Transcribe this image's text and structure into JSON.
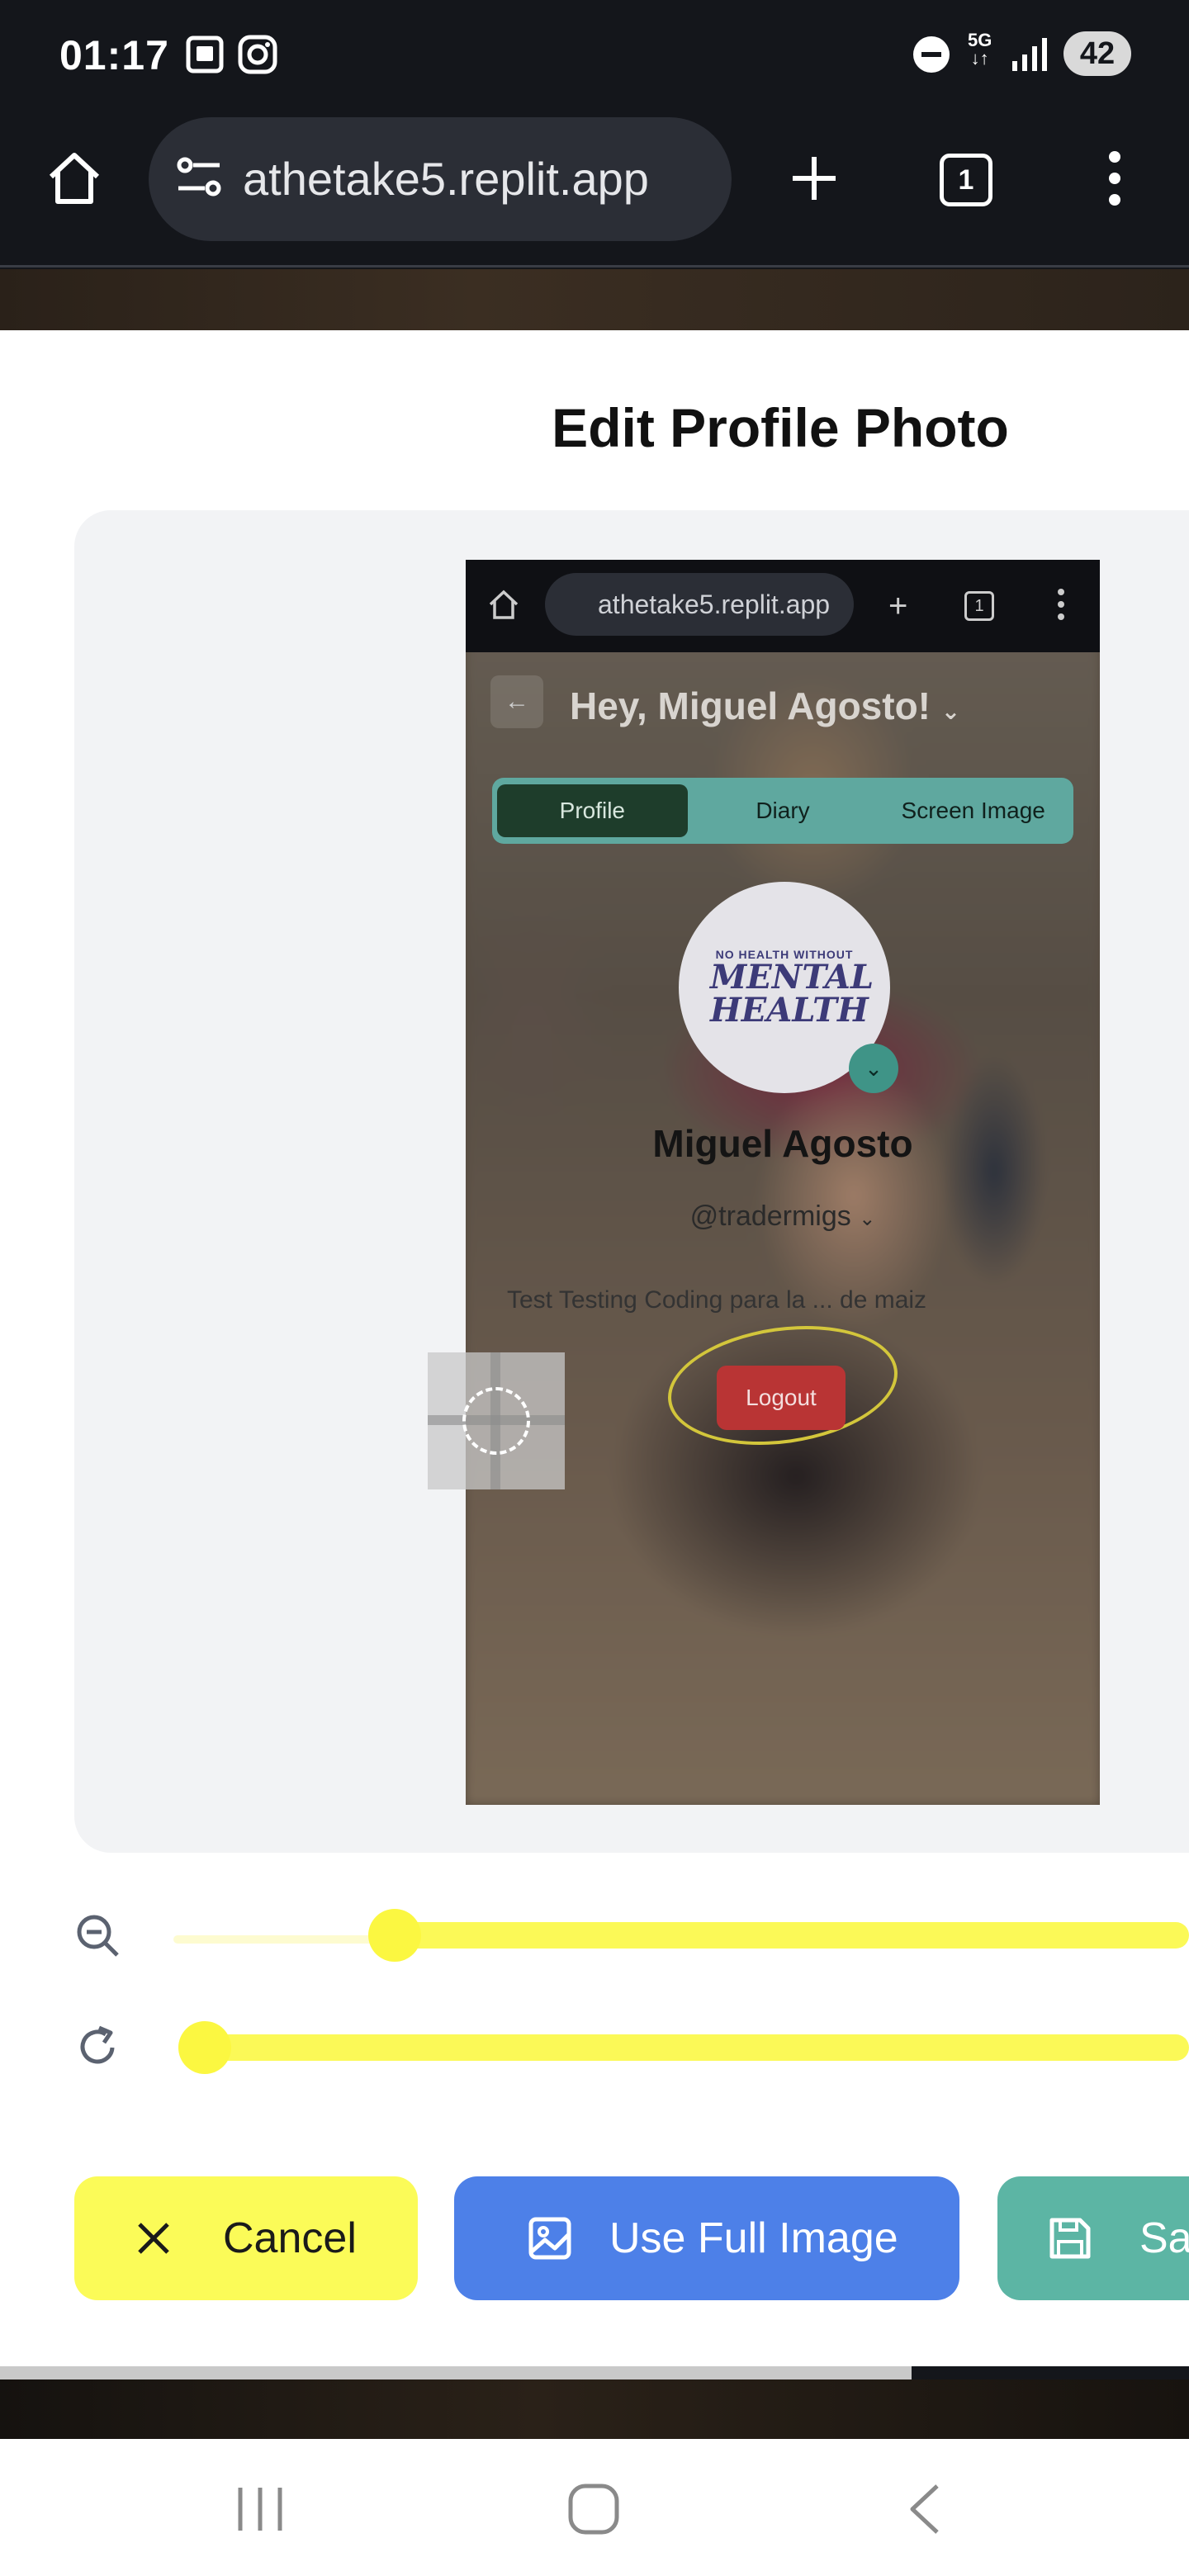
{
  "status_bar": {
    "time": "01:17",
    "network": "5G",
    "battery": "42",
    "icons": [
      "screenshot-icon",
      "instagram-icon",
      "dnd-icon",
      "signal-icon"
    ]
  },
  "browser": {
    "url": "athetake5.replit.app",
    "tab_count": "1",
    "icons": [
      "home-icon",
      "site-settings-icon",
      "new-tab-icon",
      "tabs-icon",
      "more-icon"
    ]
  },
  "modal": {
    "title": "Edit Profile Photo"
  },
  "preview": {
    "url": "athetake5.replit.app",
    "tab_count": "1",
    "greeting": "Hey, Miguel Agosto!",
    "tabs": [
      "Profile",
      "Diary",
      "Screen Image"
    ],
    "avatar_text_top": "NO HEALTH WITHOUT",
    "avatar_text_main": "MENTAL HEALTH",
    "name": "Miguel Agosto",
    "handle": "@tradermigs",
    "bio": "Test Testing Coding para la ... de maiz",
    "logout": "Logout"
  },
  "controls": {
    "zoom_level": 0.2,
    "rotate_level": 0.02,
    "icons": [
      "zoom-out-icon",
      "rotate-icon"
    ]
  },
  "buttons": {
    "cancel": "Cancel",
    "use_full_image": "Use Full Image",
    "save": "Save"
  },
  "colors": {
    "cancel_bg": "#fbfb58",
    "full_bg": "#4d80e8",
    "save_bg": "#5cb5a4",
    "slider": "#fbf741"
  }
}
